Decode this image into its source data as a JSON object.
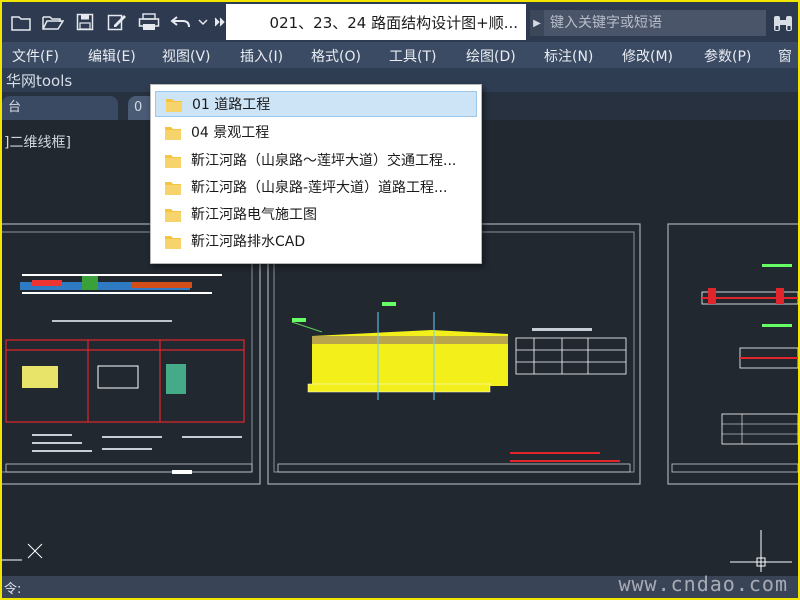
{
  "window": {
    "title": "021、23、24 路面结构设计图+顺..."
  },
  "search": {
    "placeholder": "键入关键字或短语"
  },
  "quick_access": [
    "folder-open-icon",
    "open-icon",
    "save-icon",
    "edit-icon",
    "print-icon",
    "undo-icon",
    "more-icon"
  ],
  "menu": [
    {
      "label": "文件(F)"
    },
    {
      "label": "编辑(E)"
    },
    {
      "label": "视图(V)"
    },
    {
      "label": "插入(I)"
    },
    {
      "label": "格式(O)"
    },
    {
      "label": "工具(T)"
    },
    {
      "label": "绘图(D)"
    },
    {
      "label": "标注(N)"
    },
    {
      "label": "修改(M)"
    },
    {
      "label": "参数(P)"
    },
    {
      "label": "窗"
    }
  ],
  "plugin": {
    "label": "华网tools"
  },
  "tabs": [
    {
      "label": "台"
    },
    {
      "label": "0"
    }
  ],
  "viewport": {
    "label": "]二维线框]"
  },
  "dropdown": {
    "items": [
      {
        "label": "01 道路工程",
        "selected": true
      },
      {
        "label": "04 景观工程",
        "selected": false
      },
      {
        "label": "靳江河路（山泉路～莲坪大道）交通工程...",
        "selected": false
      },
      {
        "label": "靳江河路（山泉路-莲坪大道）道路工程...",
        "selected": false
      },
      {
        "label": "靳江河路电气施工图",
        "selected": false
      },
      {
        "label": "靳江河路排水CAD",
        "selected": false
      }
    ]
  },
  "command": {
    "label": "令:"
  },
  "watermark": "www.cndao.com",
  "colors": {
    "frame": "#f2e600",
    "titlebar": "#2d3a4f",
    "menubar": "#3b4b63",
    "canvas": "#212830",
    "selection": "#cde4f7",
    "folder": "#f4c542"
  }
}
